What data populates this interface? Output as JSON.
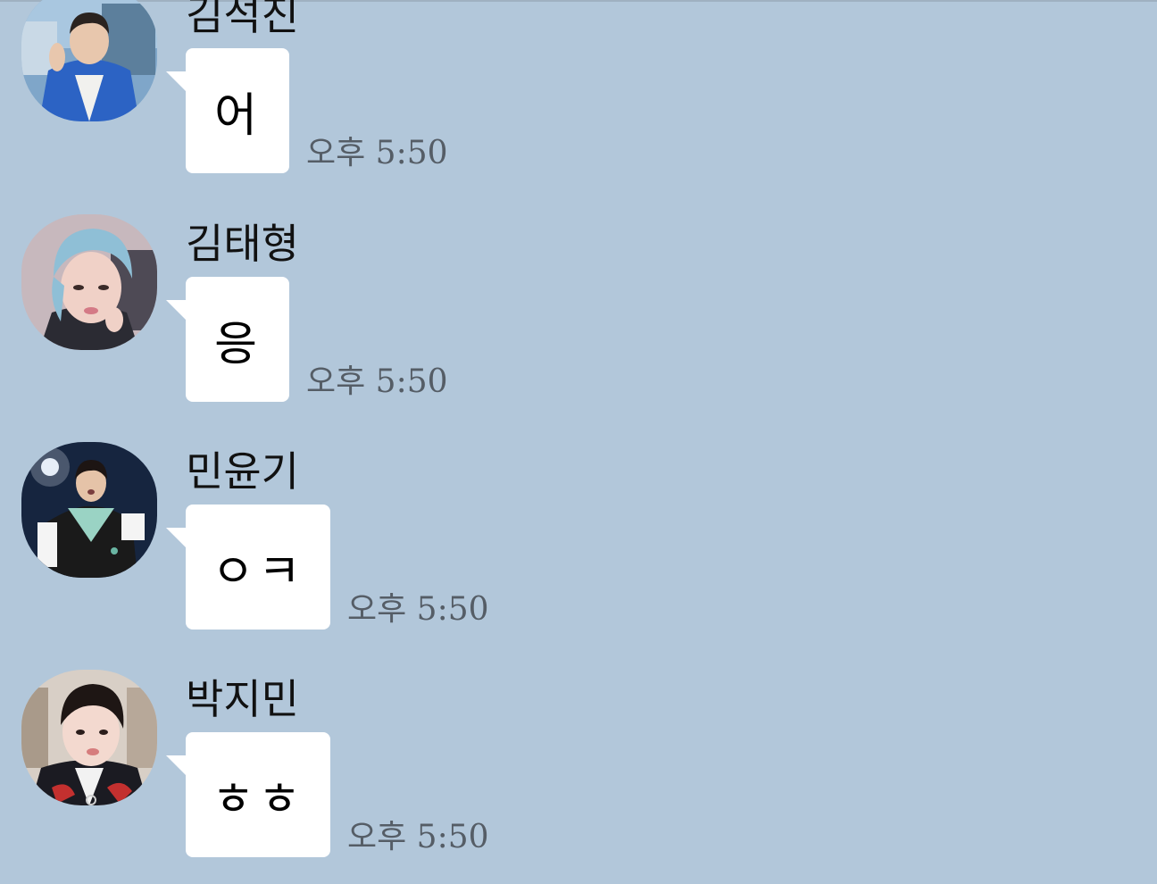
{
  "messages": [
    {
      "sender": "김석진",
      "text": "어",
      "time": "오후 5:50",
      "avatar_icon": "profile-photo-jin"
    },
    {
      "sender": "김태형",
      "text": "응",
      "time": "오후 5:50",
      "avatar_icon": "profile-photo-v"
    },
    {
      "sender": "민윤기",
      "text": "ㅇㅋ",
      "time": "오후 5:50",
      "avatar_icon": "profile-photo-suga"
    },
    {
      "sender": "박지민",
      "text": "ㅎㅎ",
      "time": "오후 5:50",
      "avatar_icon": "profile-photo-jimin"
    }
  ],
  "colors": {
    "background": "#b2c7da",
    "bubble": "#ffffff",
    "time_text": "#555d66"
  }
}
